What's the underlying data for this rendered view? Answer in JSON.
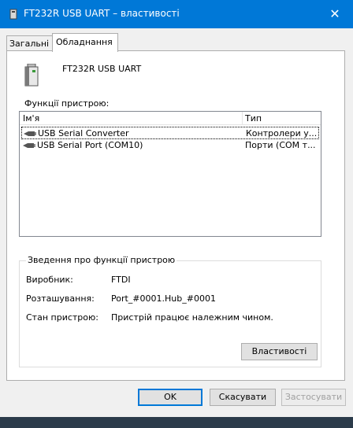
{
  "window": {
    "title": "FT232R USB UART – властивості",
    "close_glyph": "✕"
  },
  "tabs": [
    {
      "label": "Загальні"
    },
    {
      "label": "Обладнання"
    }
  ],
  "device": {
    "name": "FT232R USB UART",
    "functions_label": "Функції пристрою:"
  },
  "list": {
    "headers": {
      "name": "Ім'я",
      "type": "Тип"
    },
    "rows": [
      {
        "name": "USB Serial Converter",
        "type": "Контролери у..."
      },
      {
        "name": "USB Serial Port (COM10)",
        "type": "Порти (COM т..."
      }
    ]
  },
  "details": {
    "title": "Зведення про функції пристрою",
    "manufacturer_label": "Виробник:",
    "manufacturer_value": "FTDI",
    "location_label": "Розташування:",
    "location_value": "Port_#0001.Hub_#0001",
    "status_label": "Стан пристрою:",
    "status_value": "Пристрій працює належним чином.",
    "properties_button": "Властивості"
  },
  "buttons": {
    "ok": "OK",
    "cancel": "Скасувати",
    "apply": "Застосувати"
  }
}
